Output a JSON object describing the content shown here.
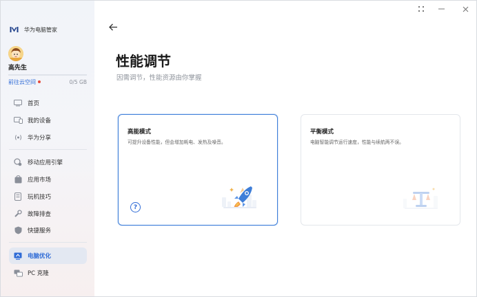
{
  "brand": {
    "name": "华为电脑管家",
    "icon": "huawei-logo-icon"
  },
  "user": {
    "name": "高先生",
    "avatar": "avatar-illustration"
  },
  "cloud": {
    "link": "前往云空间",
    "storage": "0/5 GB",
    "storage_fraction": 0,
    "dot_color": "#e54b3c"
  },
  "nav": {
    "group1": [
      {
        "label": "首页",
        "icon": "home-icon"
      },
      {
        "label": "我的设备",
        "icon": "devices-icon"
      },
      {
        "label": "华为分享",
        "icon": "share-icon"
      }
    ],
    "group2": [
      {
        "label": "移动应用引擎",
        "icon": "app-engine-icon"
      },
      {
        "label": "应用市场",
        "icon": "app-market-icon"
      },
      {
        "label": "玩机技巧",
        "icon": "tips-icon"
      },
      {
        "label": "故障排查",
        "icon": "troubleshoot-icon"
      },
      {
        "label": "快捷服务",
        "icon": "service-icon"
      }
    ],
    "group3": [
      {
        "label": "电脑优化",
        "icon": "optimize-icon",
        "active": true
      },
      {
        "label": "PC 克隆",
        "icon": "pc-clone-icon"
      }
    ]
  },
  "page": {
    "title": "性能调节",
    "subtitle": "因需调节，性能资源由你掌握"
  },
  "modes": [
    {
      "title": "高能模式",
      "description": "可提升设备性能，但会增加耗电、发热及噪音。",
      "selected": true,
      "illustration": "rocket-icon"
    },
    {
      "title": "平衡模式",
      "description": "电脑智能调节运行速度，性能与续航两不误。",
      "selected": false,
      "illustration": "balance-scale-icon"
    }
  ],
  "colors": {
    "accent": "#2f6bd6",
    "selected_border": "#3e7ed8"
  }
}
